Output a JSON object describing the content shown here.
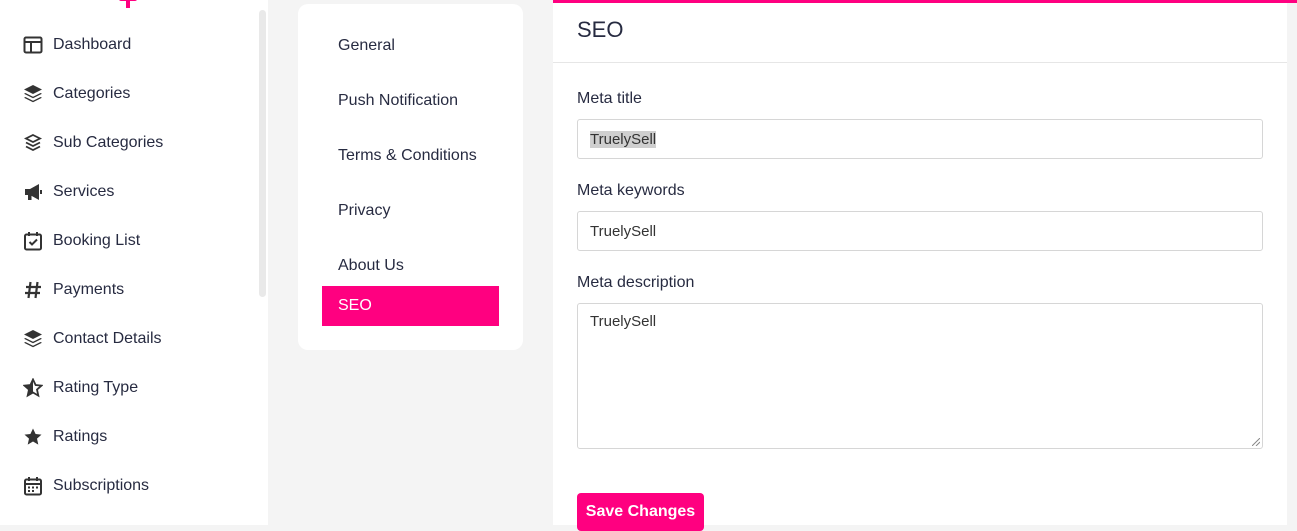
{
  "sidebar": {
    "items": [
      {
        "label": "Dashboard",
        "icon": "dashboard-icon"
      },
      {
        "label": "Categories",
        "icon": "layers-icon"
      },
      {
        "label": "Sub Categories",
        "icon": "layers-outline-icon"
      },
      {
        "label": "Services",
        "icon": "megaphone-icon"
      },
      {
        "label": "Booking List",
        "icon": "calendar-check-icon"
      },
      {
        "label": "Payments",
        "icon": "hash-icon"
      },
      {
        "label": "Contact Details",
        "icon": "layers-icon"
      },
      {
        "label": "Rating Type",
        "icon": "star-half-icon"
      },
      {
        "label": "Ratings",
        "icon": "star-icon"
      },
      {
        "label": "Subscriptions",
        "icon": "calendar-icon"
      }
    ]
  },
  "settings_menu": {
    "items": [
      {
        "label": "General"
      },
      {
        "label": "Push Notification"
      },
      {
        "label": "Terms & Conditions"
      },
      {
        "label": "Privacy"
      },
      {
        "label": "About Us"
      },
      {
        "label": "SEO",
        "active": true
      }
    ]
  },
  "main": {
    "title": "SEO",
    "meta_title": {
      "label": "Meta title",
      "value": "TruelySell"
    },
    "meta_keywords": {
      "label": "Meta keywords",
      "value": "TruelySell"
    },
    "meta_description": {
      "label": "Meta description",
      "value": "TruelySell"
    },
    "save_label": "Save Changes"
  },
  "colors": {
    "accent": "#ff0080",
    "text": "#272b41",
    "background": "#f4f4f4"
  }
}
